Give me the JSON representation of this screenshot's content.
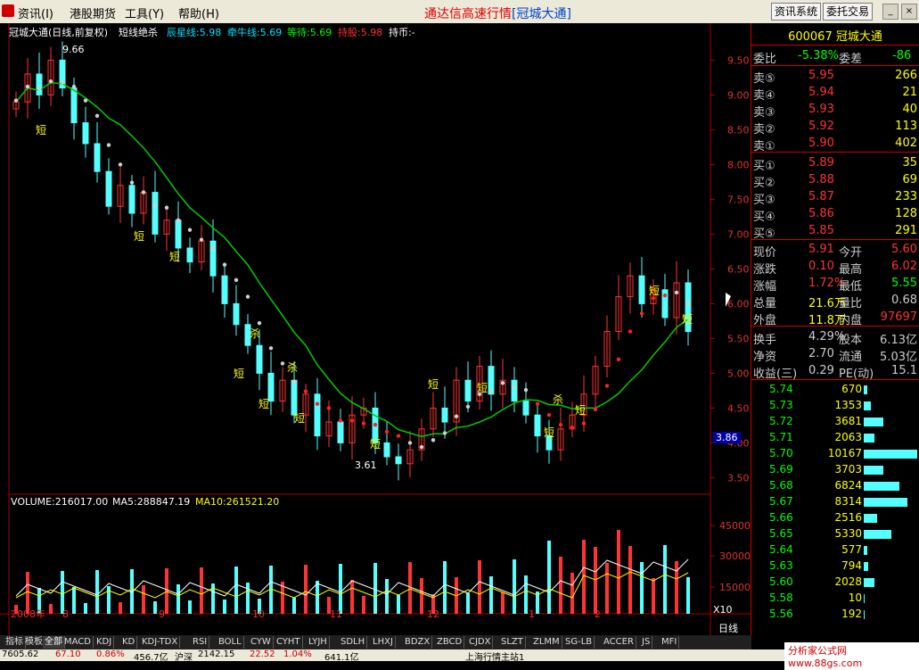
{
  "menu": {
    "items": [
      "资讯(I)",
      "港股期货",
      "工具(Y)",
      "帮助(H)"
    ],
    "app_title": "通达信高速行情",
    "app_subtitle": "[冠城大通]",
    "btn_info": "资讯系统",
    "btn_trade": "委托交易"
  },
  "chart": {
    "title_name": "冠城大通(日线,前复权)",
    "indicator_name": "短线绝杀",
    "ind_items": [
      {
        "label": "辰星线:5.98",
        "color": "#00e0ff"
      },
      {
        "label": "牵牛线:5.69",
        "color": "#00e0ff"
      },
      {
        "label": "等待:5.69",
        "color": "#00ff00"
      },
      {
        "label": "持股:5.98",
        "color": "#ff3030"
      },
      {
        "label": "持币:-",
        "color": "#ffffff"
      }
    ],
    "price_axis": [
      "9.50",
      "9.00",
      "8.50",
      "8.00",
      "7.50",
      "7.00",
      "6.50",
      "6.00",
      "5.50",
      "5.00",
      "4.50",
      "4.00",
      "3.50"
    ],
    "current_price_tag": "3.86",
    "high_label": "9.66",
    "low_label": "3.61",
    "date_labels": [
      "2008年",
      "8",
      "9",
      "10",
      "11",
      "12",
      "1",
      "2"
    ],
    "signal_short": "短",
    "signal_kill": "杀",
    "volume": {
      "line": "VOLUME:216017.00",
      "ma5": "MA5:288847.19",
      "ma10": "MA10:261521.20",
      "axis": [
        "45000",
        "30000",
        "15000"
      ],
      "unit": "X10"
    },
    "period": "日线"
  },
  "colors": {
    "up": "#ff3333",
    "down": "#54ffff",
    "ma_green": "#00cc00",
    "yellow": "#ffff00",
    "dot_grey": "#d0d0d0"
  },
  "chart_data": {
    "type": "candlestick",
    "series": [
      {
        "name": "price_close",
        "values": [
          8.9,
          9.3,
          9.0,
          9.5,
          9.1,
          8.6,
          8.3,
          7.9,
          7.4,
          7.7,
          7.3,
          7.6,
          7.0,
          7.2,
          6.8,
          6.6,
          6.9,
          6.4,
          6.0,
          5.7,
          5.4,
          5.0,
          4.6,
          4.9,
          4.4,
          4.7,
          4.1,
          4.3,
          4.0,
          4.4,
          4.5,
          4.0,
          3.8,
          3.7,
          3.9,
          4.2,
          4.5,
          4.3,
          4.9,
          4.6,
          5.1,
          4.7,
          4.9,
          4.6,
          4.4,
          4.1,
          3.9,
          4.2,
          4.4,
          4.7,
          5.1,
          5.6,
          6.1,
          6.4,
          6.0,
          6.2,
          5.8,
          6.3,
          5.6
        ]
      }
    ],
    "ylim": [
      3.3,
      9.8
    ]
  },
  "panel": {
    "code": "600067",
    "name": "冠城大通",
    "weibi_label": "委比",
    "weibi_val": "-5.38%",
    "weicha_label": "委差",
    "weicha_val": "-86",
    "sells": [
      {
        "label": "卖⑤",
        "price": "5.95",
        "vol": "266"
      },
      {
        "label": "卖④",
        "price": "5.94",
        "vol": "21"
      },
      {
        "label": "卖③",
        "price": "5.93",
        "vol": "40"
      },
      {
        "label": "卖②",
        "price": "5.92",
        "vol": "113"
      },
      {
        "label": "卖①",
        "price": "5.90",
        "vol": "402"
      }
    ],
    "buys": [
      {
        "label": "买①",
        "price": "5.89",
        "vol": "35"
      },
      {
        "label": "买②",
        "price": "5.88",
        "vol": "69"
      },
      {
        "label": "买③",
        "price": "5.87",
        "vol": "233"
      },
      {
        "label": "买④",
        "price": "5.86",
        "vol": "128"
      },
      {
        "label": "买⑤",
        "price": "5.85",
        "vol": "291"
      }
    ],
    "stats": [
      {
        "l1": "现价",
        "v1": "5.91",
        "l2": "今开",
        "v2": "5.60"
      },
      {
        "l1": "涨跌",
        "v1": "0.10",
        "l2": "最高",
        "v2": "6.02"
      },
      {
        "l1": "涨幅",
        "v1": "1.72%",
        "l2": "最低",
        "v2": "5.55"
      },
      {
        "l1": "总量",
        "v1": "21.6万",
        "l2": "量比",
        "v2": "0.68"
      },
      {
        "l1": "外盘",
        "v1": "11.8万",
        "l2": "内盘",
        "v2": "97697"
      }
    ],
    "stats2": [
      {
        "l1": "换手",
        "v1": "4.29%",
        "l2": "股本",
        "v2": "6.13亿"
      },
      {
        "l1": "净资",
        "v1": "2.70",
        "l2": "流通",
        "v2": "5.03亿"
      },
      {
        "l1": "收益(三)",
        "v1": "0.29",
        "l2": "PE(动)",
        "v2": "15.1"
      }
    ],
    "price_dist": [
      {
        "p": "5.74",
        "v": "670",
        "w": 0.07
      },
      {
        "p": "5.73",
        "v": "1353",
        "w": 0.13
      },
      {
        "p": "5.72",
        "v": "3681",
        "w": 0.36
      },
      {
        "p": "5.71",
        "v": "2063",
        "w": 0.2
      },
      {
        "p": "5.70",
        "v": "10167",
        "w": 1.0
      },
      {
        "p": "5.69",
        "v": "3703",
        "w": 0.36
      },
      {
        "p": "5.68",
        "v": "6824",
        "w": 0.67
      },
      {
        "p": "5.67",
        "v": "8314",
        "w": 0.82
      },
      {
        "p": "5.66",
        "v": "2516",
        "w": 0.25
      },
      {
        "p": "5.65",
        "v": "5330",
        "w": 0.52
      },
      {
        "p": "5.64",
        "v": "577",
        "w": 0.06
      },
      {
        "p": "5.63",
        "v": "794",
        "w": 0.08
      },
      {
        "p": "5.60",
        "v": "2028",
        "w": 0.2
      },
      {
        "p": "5.58",
        "v": "10",
        "w": 0.01
      },
      {
        "p": "5.56",
        "v": "192",
        "w": 0.02
      }
    ]
  },
  "tabs": [
    "指标",
    "模板",
    "全部",
    "MACD",
    "KDJ",
    "KD",
    "KDJ-TDX",
    "RSI",
    "BOLL",
    "CYW",
    "CYHT",
    "LYJH",
    "SDLH",
    "LHXJ",
    "BDZX",
    "ZBCD",
    "CJDX",
    "SLZT",
    "ZLMM",
    "SG-LB",
    "ACCER",
    "JS",
    "MFI"
  ],
  "status": {
    "index": "7605.62",
    "change": "67.10",
    "pct": "0.86%",
    "amount": "456.7亿",
    "sz_label": "沪深",
    "sz_val": "2142.15",
    "sz_change": "22.52",
    "sz_pct": "1.04%",
    "sz_amount": "641.1亿",
    "station": "上海行情主站1"
  },
  "watermark": "分析家公式网 www.88gs.com"
}
